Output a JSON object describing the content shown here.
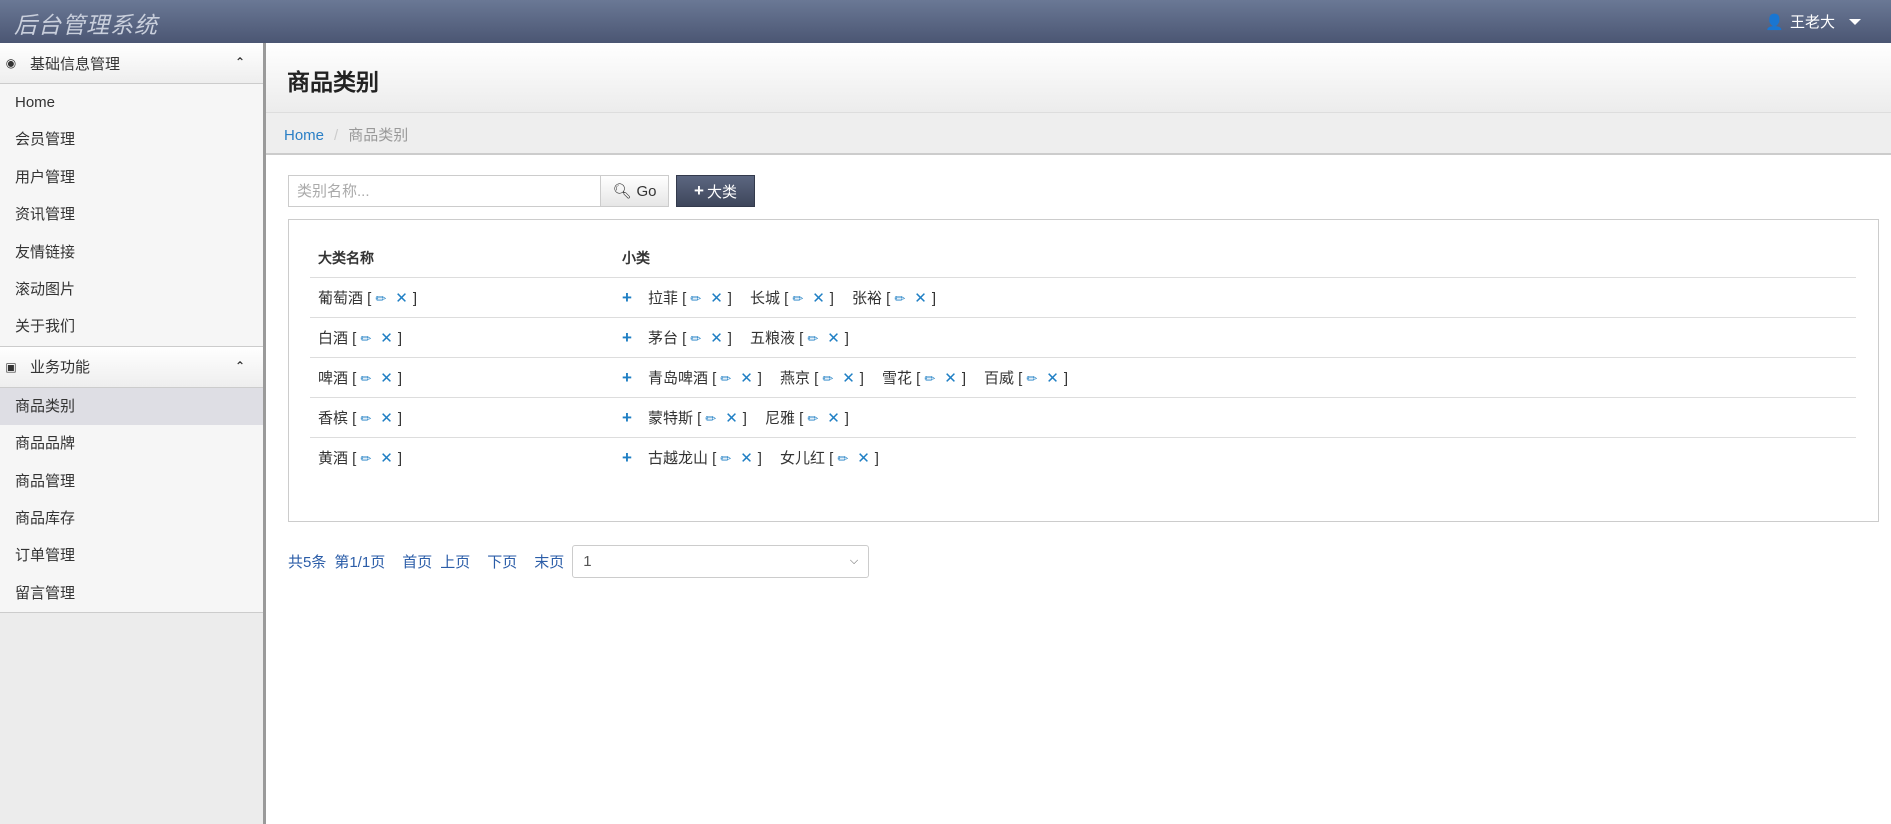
{
  "header": {
    "brand": "后台管理系统",
    "user": "王老大"
  },
  "sidebar": {
    "groups": [
      {
        "title": "基础信息管理",
        "items": [
          "Home",
          "会员管理",
          "用户管理",
          "资讯管理",
          "友情链接",
          "滚动图片",
          "关于我们"
        ]
      },
      {
        "title": "业务功能",
        "items": [
          "商品类别",
          "商品品牌",
          "商品管理",
          "商品库存",
          "订单管理",
          "留言管理"
        ],
        "active": "商品类别"
      }
    ]
  },
  "page": {
    "title": "商品类别",
    "breadcrumb": [
      "Home",
      "商品类别"
    ]
  },
  "toolbar": {
    "search_placeholder": "类别名称...",
    "go_label": "Go",
    "add_label": "大类"
  },
  "table": {
    "headers": [
      "大类名称",
      "小类"
    ],
    "rows": [
      {
        "name": "葡萄酒",
        "subs": [
          "拉菲",
          "长城",
          "张裕"
        ]
      },
      {
        "name": "白酒",
        "subs": [
          "茅台",
          "五粮液"
        ]
      },
      {
        "name": "啤酒",
        "subs": [
          "青岛啤酒",
          "燕京",
          "雪花",
          "百威"
        ]
      },
      {
        "name": "香槟",
        "subs": [
          "蒙特斯",
          "尼雅"
        ]
      },
      {
        "name": "黄酒",
        "subs": [
          "古越龙山",
          "女儿红"
        ]
      }
    ]
  },
  "pagination": {
    "total": "共5条",
    "page": "第1/1页",
    "first": "首页",
    "prev": "上页",
    "next": "下页",
    "last": "末页",
    "selected": "1"
  }
}
